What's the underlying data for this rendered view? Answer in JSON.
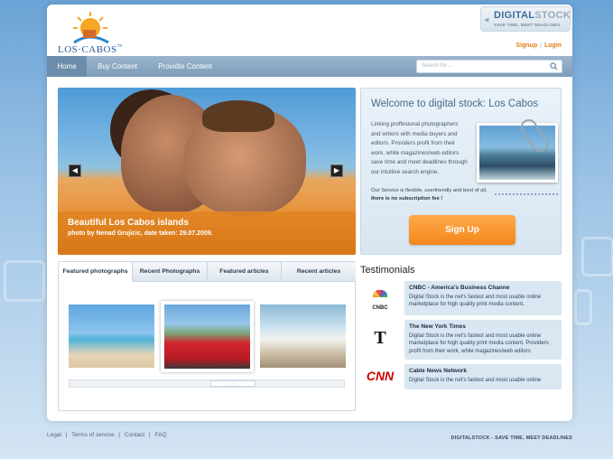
{
  "brand": {
    "name": "LOS·CABOS",
    "trademark": "™"
  },
  "badge": {
    "title_a": "DIGITAL",
    "title_b": "STOCK",
    "tagline": "SAVE TIME, MEET DEADLINES"
  },
  "auth": {
    "signup": "Signup",
    "sep": "|",
    "login": "Login"
  },
  "nav": {
    "items": [
      {
        "label": "Home",
        "active": true
      },
      {
        "label": "Buy Content"
      },
      {
        "label": "Providte Content"
      }
    ],
    "search_placeholder": "Search for ..."
  },
  "hero": {
    "title": "Beautiful Los Cabos islands",
    "subtitle": "photo by Nenad Grujicic, date taken: 29.07.2009.",
    "prev": "◀",
    "next": "▶"
  },
  "welcome": {
    "heading": "Welcome to digital stock: Los Cabos",
    "text": "Linking proffesional photographers and writers with media buyers and editors. Providers profit from their work, while magazines/web editors save time and meet deadlines through our intuitive search engine.",
    "text2_a": "Our Service is flexible, userfriendly and best of all, ",
    "text2_b": "there is no subscription  fee !",
    "signup_button": "Sign Up"
  },
  "tabs": [
    "Featured photographs",
    "Recent Photographs",
    "Featured articles",
    "Recent articles"
  ],
  "testimonials": {
    "title": "Testimonials",
    "items": [
      {
        "logo": "NBC",
        "name": "CNBC - America's Business Channe",
        "text": "Digital Stock is the net's fastest and most usable online marketplace for high quality print media content."
      },
      {
        "logo": "T",
        "name": "The New York Times",
        "text": "Digital Stock is the net's fastest and most usable online marketplace for high quality print media content. Providers profit from their work, while magazines/web editors"
      },
      {
        "logo": "CNN",
        "name": "Cable News Network",
        "text": "Digital Stock is the net's fastest and most usable online"
      }
    ]
  },
  "footer": {
    "links": [
      "Legal",
      "|",
      "Terms of service",
      "|",
      "Contact",
      "|",
      "FAQ"
    ],
    "tagline": "DIGITALSTOCK - SAVE TIME, MEET DEADLINES"
  },
  "colors": {
    "accent": "#f2871a",
    "nav": "#7e9cb9",
    "link": "#e57e10"
  }
}
